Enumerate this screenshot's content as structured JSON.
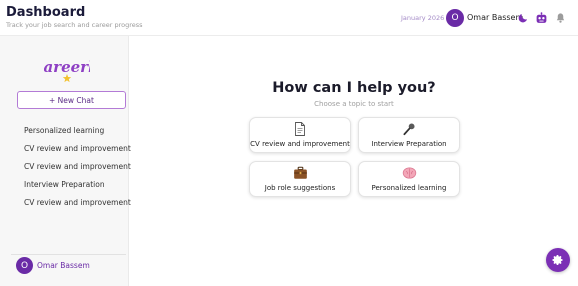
{
  "header": {
    "title": "Dashboard",
    "subtitle": "Track your job search and career progress",
    "date": "January 2026",
    "avatar_initial": "O",
    "user_name": "Omar Bassem"
  },
  "sidebar": {
    "logo_text": "Careerly",
    "new_chat_label": "+ New Chat",
    "history": [
      "Personalized learning",
      "CV review and improvement",
      "CV review and improvement",
      "Interview Preparation",
      "CV review and improvement"
    ],
    "user": {
      "avatar_initial": "O",
      "name": "Omar Bassem"
    }
  },
  "main": {
    "title": "How can I help you?",
    "subtitle": "Choose a topic to start",
    "topics": [
      {
        "label": "CV review and improvement",
        "icon": "document-icon"
      },
      {
        "label": "Interview Preparation",
        "icon": "microphone-icon"
      },
      {
        "label": "Job role suggestions",
        "icon": "briefcase-icon"
      },
      {
        "label": "Personalized learning",
        "icon": "brain-icon"
      }
    ]
  },
  "colors": {
    "accent": "#6a2ba6",
    "fab": "#7b2fb5",
    "logo": "#8e3fc4",
    "logo_star": "#f2c230"
  },
  "icons": {
    "theme_toggle": "moon-icon",
    "assistant": "robot-icon",
    "notifications": "bell-icon",
    "fab": "settings-gear-icon"
  }
}
